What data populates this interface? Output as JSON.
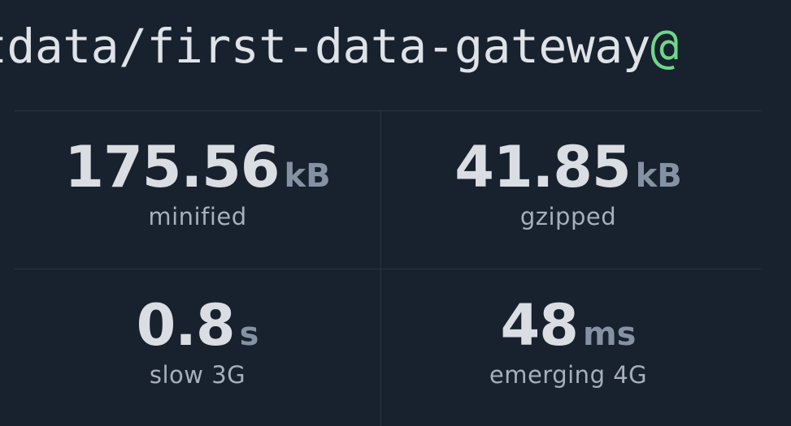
{
  "package": {
    "name_visible": "tdata/first-data-gateway",
    "at_fragment": "@"
  },
  "stats": {
    "minified": {
      "value": "175.56",
      "unit": "kB",
      "label": "minified"
    },
    "gzipped": {
      "value": "41.85",
      "unit": "kB",
      "label": "gzipped"
    },
    "slow3g": {
      "value": "0.8",
      "unit": "s",
      "label": "slow 3G"
    },
    "emerging4g": {
      "value": "48",
      "unit": "ms",
      "label": "emerging 4G"
    }
  },
  "colors": {
    "background": "#18212e",
    "accent_green": "#6fd68a",
    "unit_gray": "#8592a3",
    "divider": "#2a3442"
  }
}
